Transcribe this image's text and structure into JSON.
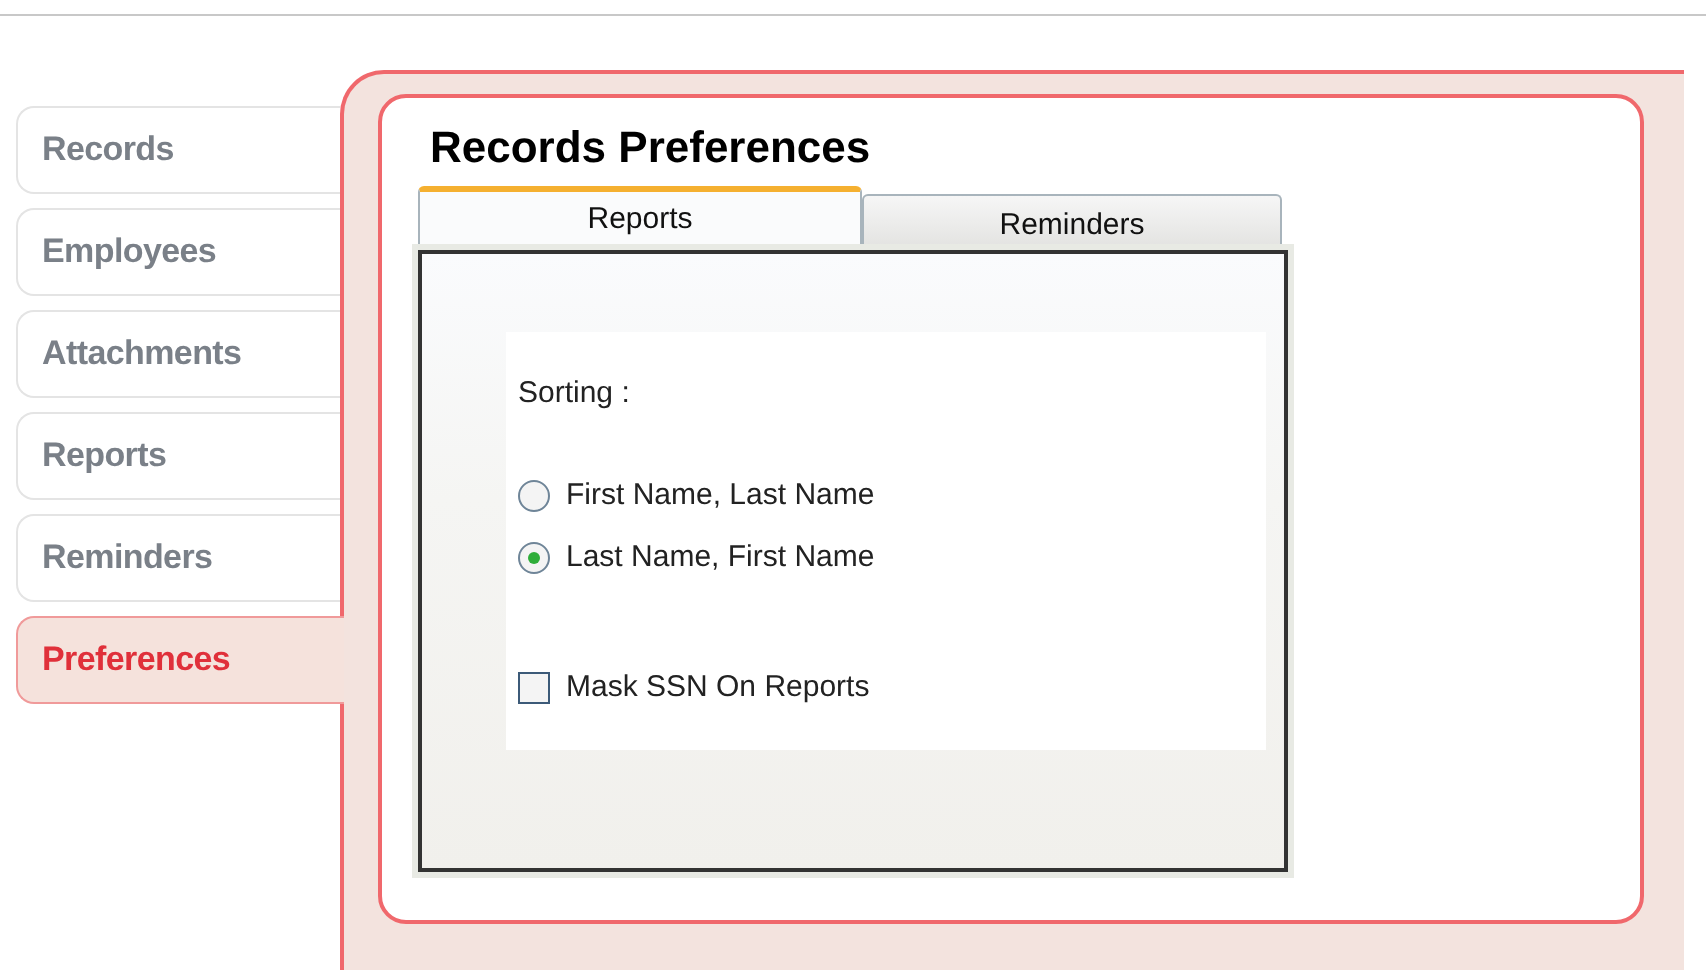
{
  "sidebar": {
    "items": [
      {
        "label": "Records",
        "selected": false
      },
      {
        "label": "Employees",
        "selected": false
      },
      {
        "label": "Attachments",
        "selected": false
      },
      {
        "label": "Reports",
        "selected": false
      },
      {
        "label": "Reminders",
        "selected": false
      },
      {
        "label": "Preferences",
        "selected": true
      }
    ]
  },
  "panel": {
    "title": "Records Preferences",
    "tabs": [
      {
        "label": "Reports",
        "selected": true
      },
      {
        "label": "Reminders",
        "selected": false
      }
    ],
    "sorting_label": "Sorting :",
    "sort_options": [
      {
        "label": "First Name, Last Name",
        "selected": false
      },
      {
        "label": "Last Name, First Name",
        "selected": true
      }
    ],
    "mask_ssn": {
      "label": "Mask SSN On Reports",
      "checked": false
    }
  }
}
